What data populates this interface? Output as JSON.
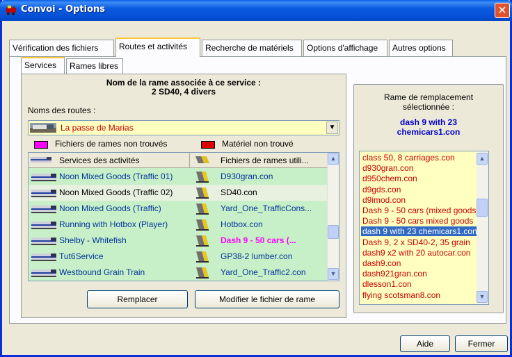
{
  "window": {
    "title": "Convoi - Options",
    "close_glyph": "✕"
  },
  "tabs": [
    {
      "label": "Vérification des fichiers"
    },
    {
      "label": "Routes et activités"
    },
    {
      "label": "Recherche de matériels"
    },
    {
      "label": "Options d'affichage"
    },
    {
      "label": "Autres options"
    }
  ],
  "subtabs": [
    {
      "label": "Services"
    },
    {
      "label": "Rames libres"
    }
  ],
  "services": {
    "heading_line1": "Nom de la rame associée à ce service :",
    "heading_line2": "2 SD40, 4 divers",
    "routes_label": "Noms des routes :",
    "route_selected": "La passe de Marias",
    "legend_missing_files": "Fichiers de rames non trouvés",
    "legend_missing_material": "Matériel non trouvé",
    "legend_colors": {
      "missing_files": "#ff00ff",
      "missing_material": "#dd0000"
    },
    "columns": {
      "activities": "Services des activités",
      "files": "Fichiers de rames utili..."
    },
    "rows": [
      {
        "activity": "Noon Mixed Goods (Traffic 01)",
        "file": "D930gran.con"
      },
      {
        "activity": "Noon Mixed Goods (Traffic 02)",
        "file": "SD40.con"
      },
      {
        "activity": "Noon Mixed Goods (Traffic)",
        "file": "Yard_One_TrafficCons..."
      },
      {
        "activity": "Running with Hotbox (Player)",
        "file": "Hotbox.con"
      },
      {
        "activity": "Shelby - Whitefish",
        "file": "Dash 9 - 50 cars (..."
      },
      {
        "activity": "Tut6Service",
        "file": "GP38-2 lumber.con"
      },
      {
        "activity": "Westbound Grain Train",
        "file": "Yard_One_Traffic2.con"
      }
    ],
    "replace_button": "Remplacer",
    "modify_button": "Modifier le fichier de rame"
  },
  "replacement": {
    "label_line1": "Rame de remplacement",
    "label_line2": "sélectionnée :",
    "selected_line1": "dash 9 with 23",
    "selected_line2": "chemicars1.con",
    "items": [
      "class 50, 8 carriages.con",
      "d930gran.con",
      "d950chem.con",
      "d9gds.con",
      "d9imod.con",
      "Dash 9 - 50 cars (mixed goods)",
      "Dash 9 - 50 cars mixed goods",
      "dash 9 with 23 chemicars1.con",
      "Dash 9, 2 x SD40-2, 35 grain",
      "dash9 x2 with 20 autocar.con",
      "dash9.con",
      "dash921gran.con",
      "dlesson1.con",
      "flying scotsman8.con"
    ]
  },
  "footer": {
    "help_button": "Aide",
    "close_button": "Fermer"
  },
  "colors": {
    "title_blue": "#0a5be0",
    "row_green": "#c8f0c8",
    "list_yellow": "#ffffc0",
    "item_red": "#cc0000",
    "selection": "#316ac5",
    "highlight_magenta": "#ff00ff"
  }
}
